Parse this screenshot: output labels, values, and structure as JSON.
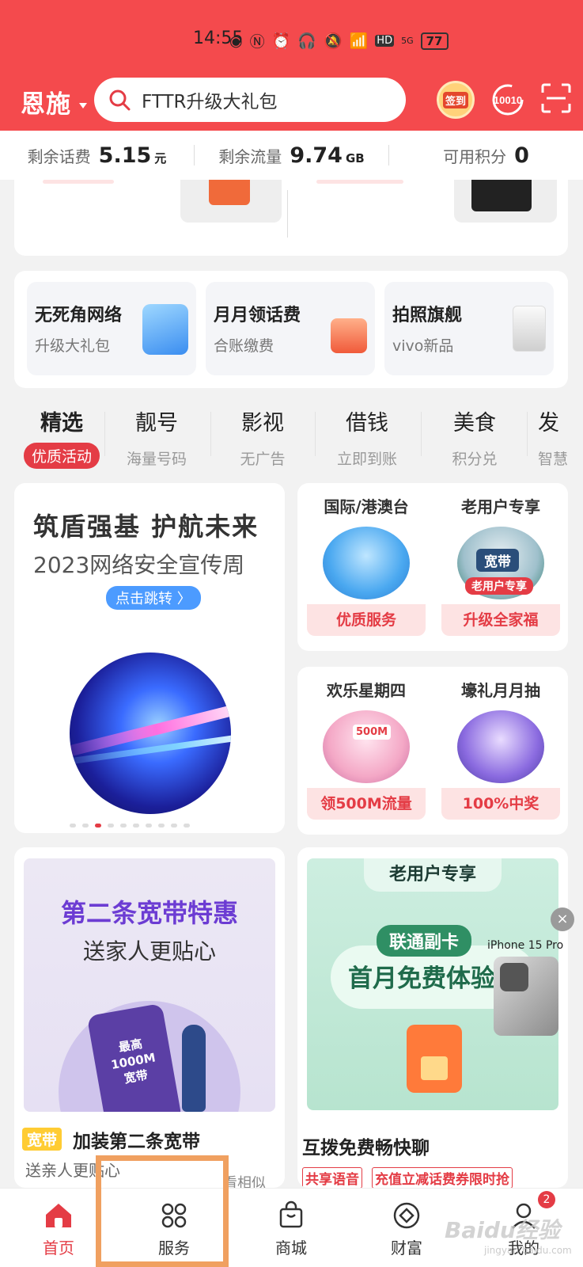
{
  "status": {
    "time": "14:55",
    "network": "5G",
    "hd": "HD",
    "battery": "77"
  },
  "header": {
    "city": "恩施",
    "search_placeholder": "FTTR升级大礼包",
    "signin_label": "签到",
    "service_number": "10010"
  },
  "balance": [
    {
      "label": "剩余话费",
      "value": "5.15",
      "unit": "元"
    },
    {
      "label": "剩余流量",
      "value": "9.74",
      "unit": "GB"
    },
    {
      "label": "可用积分",
      "value": "0",
      "unit": ""
    }
  ],
  "promos": [
    {
      "title": "无死角网络",
      "subtitle": "升级大礼包"
    },
    {
      "title": "月月领话费",
      "subtitle": "合账缴费"
    },
    {
      "title": "拍照旗舰",
      "subtitle": "vivo新品"
    }
  ],
  "categories": [
    {
      "title": "精选",
      "subtitle": "优质活动"
    },
    {
      "title": "靓号",
      "subtitle": "海量号码"
    },
    {
      "title": "影视",
      "subtitle": "无广告"
    },
    {
      "title": "借钱",
      "subtitle": "立即到账"
    },
    {
      "title": "美食",
      "subtitle": "积分兑"
    },
    {
      "title": "发",
      "subtitle": "智慧"
    }
  ],
  "banner": {
    "title": "筑盾强基  护航未来",
    "subtitle": "2023网络安全宣传周",
    "button": "点击跳转 〉",
    "page_count": 10,
    "active_page": 3
  },
  "tiles": [
    {
      "title": "国际/港澳台",
      "tag": "优质服务",
      "color": "#4aa8f0"
    },
    {
      "title": "老用户专享",
      "tag": "升级全家福",
      "color": "#2a7a6a",
      "inner_label": "宽带",
      "ribbon": "老用户专享"
    },
    {
      "title": "欢乐星期四",
      "tag": "领500M流量",
      "color": "#f4a8c6",
      "inner_label": "500M"
    },
    {
      "title": "壕礼月月抽",
      "tag": "100%中奖",
      "color": "#8b6be0"
    }
  ],
  "broadband": {
    "headline": "第二条宽带特惠",
    "subline": "送家人更贴心",
    "phone_text": "最高\n1000M\n宽带",
    "tag": "宽带",
    "title": "加装第二条宽带",
    "desc": "送亲人更贴心"
  },
  "fuka": {
    "header": "老用户专享",
    "pill_tag": "联通副卡",
    "pill_text": "首月免费体验",
    "title": "互拨免费畅快聊",
    "tag1": "共享语音",
    "tag2": "充值立减话费券限时抢"
  },
  "float_ad": {
    "label": "iPhone 15 Pro",
    "close": "×"
  },
  "similar": "看相似",
  "tabs": [
    {
      "label": "首页"
    },
    {
      "label": "服务"
    },
    {
      "label": "商城"
    },
    {
      "label": "财富"
    },
    {
      "label": "我的",
      "badge": "2"
    }
  ],
  "watermark": {
    "brand": "Baidu经验",
    "url": "jingyan.baidu.com"
  }
}
